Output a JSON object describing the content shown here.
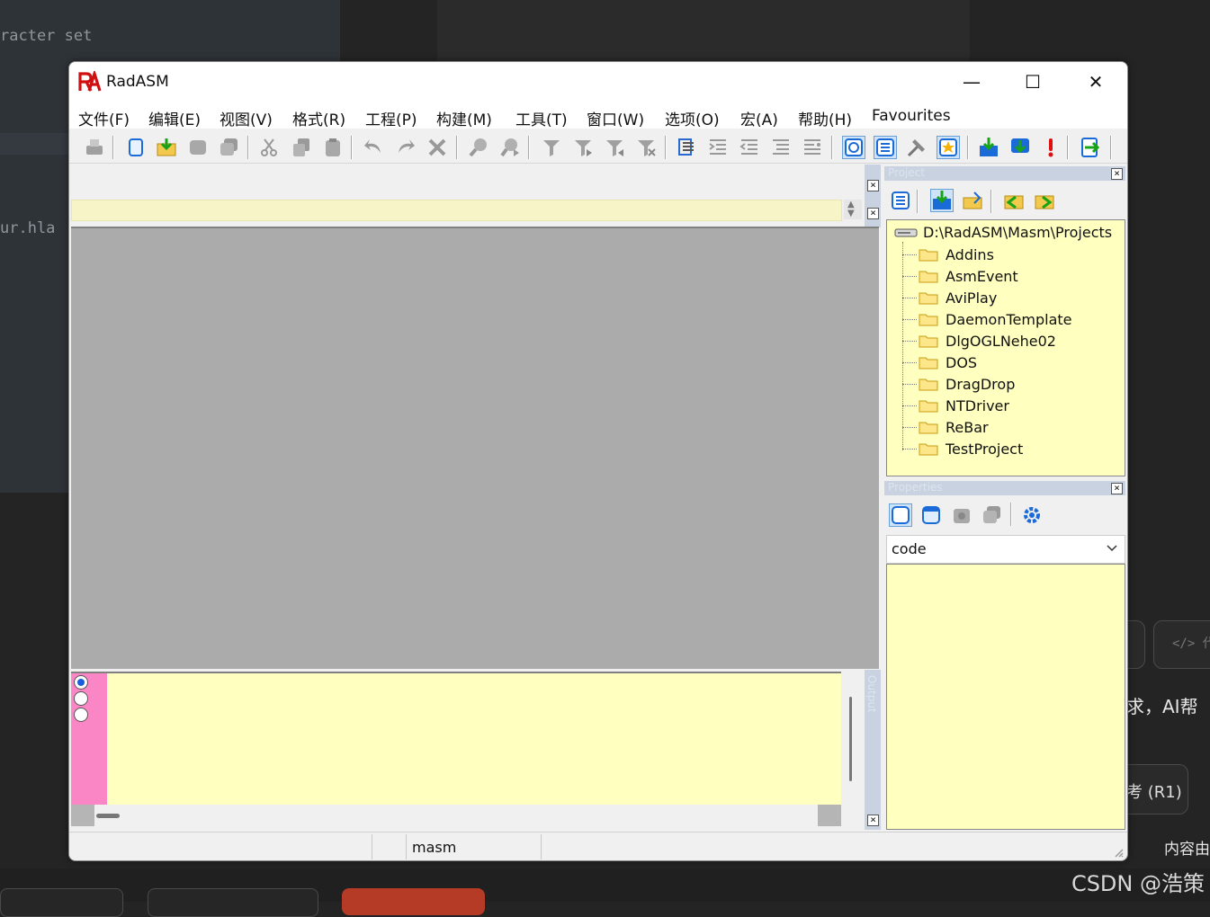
{
  "background": {
    "left_lines": [
      "racter set",
      "ur.hla"
    ],
    "right_texts": [
      "求，AI帮",
      "考 (R1)",
      "内容由"
    ],
    "watermark": "CSDN @浩策"
  },
  "window": {
    "title": "RadASM",
    "controls": {
      "minimize": "—",
      "maximize": "☐",
      "close": "✕"
    }
  },
  "menu": [
    "文件(F)",
    "编辑(E)",
    "视图(V)",
    "格式(R)",
    "工程(P)",
    "构建(M)",
    "工具(T)",
    "窗口(W)",
    "选项(O)",
    "宏(A)",
    "帮助(H)",
    "Favourites"
  ],
  "panels": {
    "project_title": "Project",
    "properties_title": "Properties",
    "output_title": "Output"
  },
  "project_tree": {
    "root": "D:\\RadASM\\Masm\\Projects",
    "items": [
      "Addins",
      "AsmEvent",
      "AviPlay",
      "DaemonTemplate",
      "DlgOGLNehe02",
      "DOS",
      "DragDrop",
      "NTDriver",
      "ReBar",
      "TestProject"
    ]
  },
  "properties": {
    "selected": "code"
  },
  "status": {
    "assembler": "masm"
  },
  "colors": {
    "pane_yellow": "#ffffc0",
    "pink_margin": "#fb86c6",
    "accent_blue": "#1a5ed8"
  }
}
